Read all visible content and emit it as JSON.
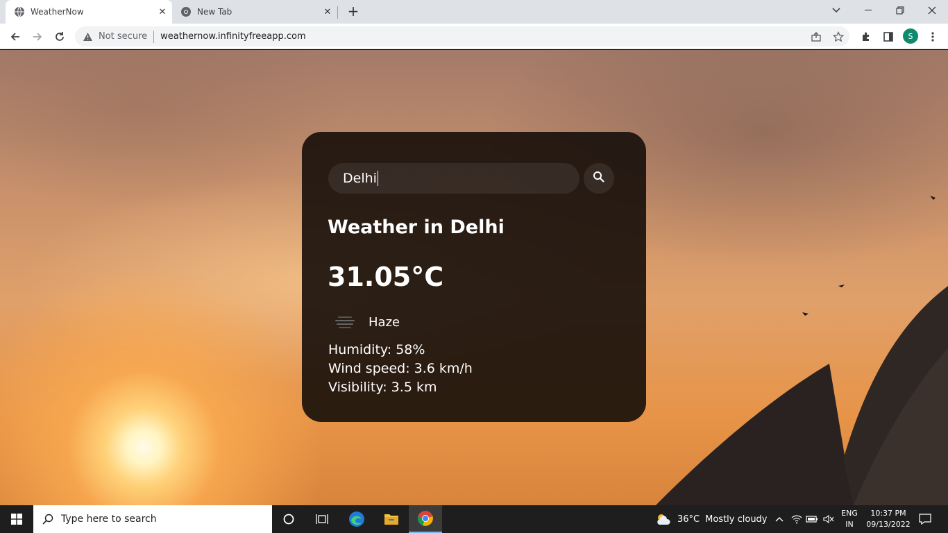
{
  "browser": {
    "tabs": [
      {
        "title": "WeatherNow",
        "active": true
      },
      {
        "title": "New Tab",
        "active": false
      }
    ],
    "security_label": "Not secure",
    "url": "weathernow.infinityfreeapp.com",
    "profile_initial": "S"
  },
  "weather_card": {
    "search_value": "Delhi",
    "title": "Weather in Delhi",
    "temperature": "31.05°C",
    "description": "Haze",
    "humidity": "Humidity: 58%",
    "wind": "Wind speed: 3.6 km/h",
    "visibility": "Visibility: 3.5 km"
  },
  "taskbar": {
    "search_placeholder": "Type here to search",
    "weather": {
      "temp": "36°C",
      "condition": "Mostly cloudy"
    },
    "lang": {
      "line1": "ENG",
      "line2": "IN"
    },
    "clock": {
      "time": "10:37 PM",
      "date": "09/13/2022"
    }
  },
  "colors": {
    "card_bg": "#160e0a",
    "sky_orange": "#e79448",
    "profile": "#0f8a6c",
    "taskbar": "#1e1e1e"
  }
}
